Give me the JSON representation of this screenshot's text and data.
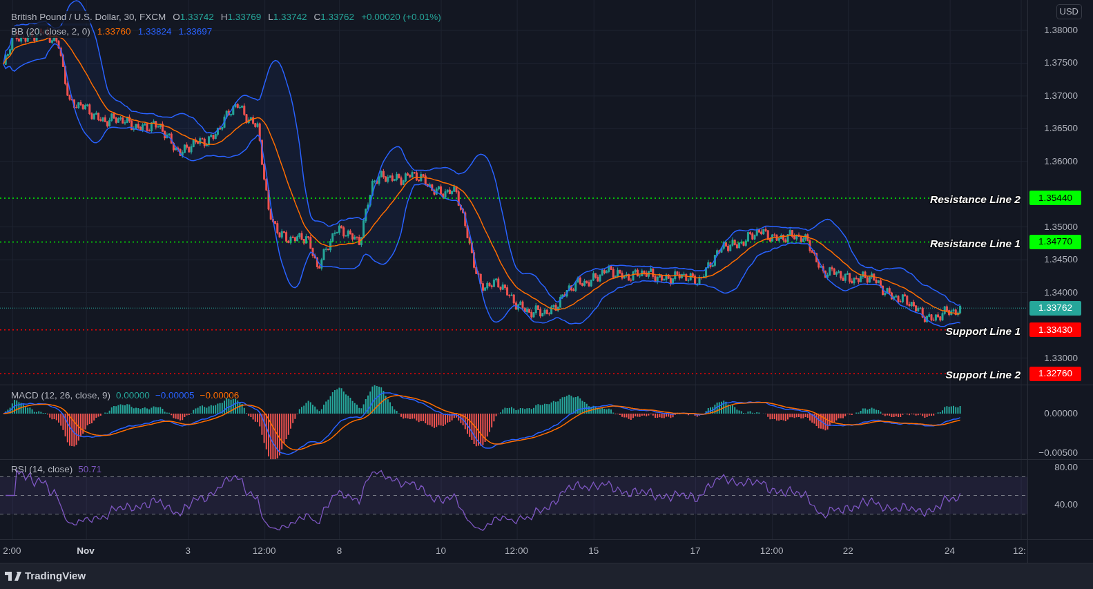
{
  "legend": {
    "symbol": "British Pound / U.S. Dollar, 30, FXCM",
    "ohlc": [
      {
        "label": "O",
        "value": "1.33742"
      },
      {
        "label": "H",
        "value": "1.33769"
      },
      {
        "label": "L",
        "value": "1.33742"
      },
      {
        "label": "C",
        "value": "1.33762"
      }
    ],
    "change": "+0.00020 (+0.01%)"
  },
  "bb": {
    "label": "BB (20, close, 2, 0)",
    "values": [
      {
        "text": "1.33760",
        "color": "#ff6d00"
      },
      {
        "text": "1.33824",
        "color": "#2962ff"
      },
      {
        "text": "1.33697",
        "color": "#2962ff"
      }
    ]
  },
  "price_axis": {
    "currency": "USD",
    "ticks": [
      "1.38000",
      "1.37500",
      "1.37000",
      "1.36500",
      "1.36000",
      "1.35000",
      "1.34500",
      "1.34000",
      "1.33000"
    ]
  },
  "levels": [
    {
      "kind": "resistance",
      "label": "Resistance Line 2",
      "price": "1.35440",
      "color": "#00ff00"
    },
    {
      "kind": "resistance",
      "label": "Resistance Line 1",
      "price": "1.34770",
      "color": "#00ff00"
    },
    {
      "kind": "support",
      "label": "Support Line 1",
      "price": "1.33430",
      "color": "#ff0000"
    },
    {
      "kind": "support",
      "label": "Support Line 2",
      "price": "1.32760",
      "color": "#ff0000"
    }
  ],
  "last_price": {
    "price": "1.33762",
    "color": "#26a69a"
  },
  "macd": {
    "label": "MACD (12, 26, close, 9)",
    "values": [
      {
        "text": "0.00000",
        "color": "#26a69a"
      },
      {
        "text": "−0.00005",
        "color": "#2962ff"
      },
      {
        "text": "−0.00006",
        "color": "#ff6d00"
      }
    ],
    "ticks": [
      "0.00000",
      "−0.00500"
    ]
  },
  "rsi": {
    "label": "RSI (14, close)",
    "value": "50.71",
    "ticks": [
      "80.00",
      "40.00"
    ]
  },
  "time_axis": [
    {
      "kind": "time",
      "text": "2:00"
    },
    {
      "kind": "month",
      "text": "Nov"
    },
    {
      "kind": "day",
      "text": "3"
    },
    {
      "kind": "time",
      "text": "12:00"
    },
    {
      "kind": "day",
      "text": "8"
    },
    {
      "kind": "day",
      "text": "10"
    },
    {
      "kind": "time",
      "text": "12:00"
    },
    {
      "kind": "day",
      "text": "15"
    },
    {
      "kind": "day",
      "text": "17"
    },
    {
      "kind": "time",
      "text": "12:00"
    },
    {
      "kind": "day",
      "text": "22"
    },
    {
      "kind": "day",
      "text": "24"
    },
    {
      "kind": "time",
      "text": "12:"
    }
  ],
  "brand": "TradingView"
}
